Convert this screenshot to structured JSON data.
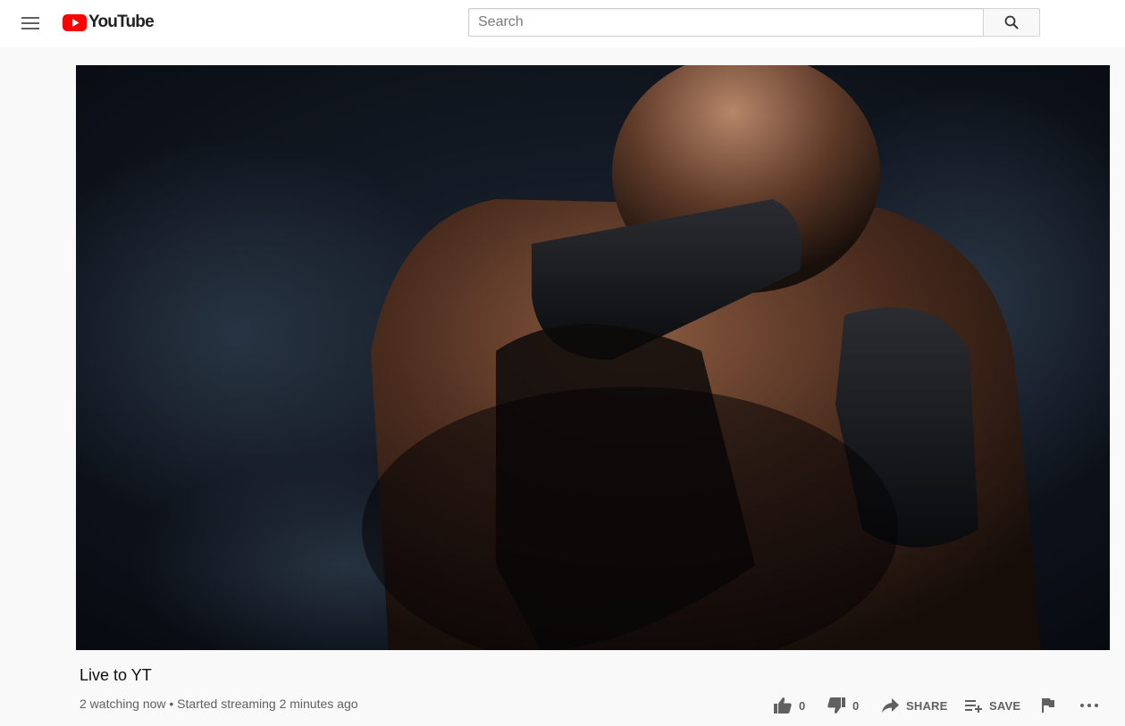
{
  "header": {
    "logo_text": "YouTube",
    "search": {
      "placeholder": "Search",
      "value": ""
    }
  },
  "video": {
    "title": "Live to YT",
    "meta": "2 watching now • Started streaming 2 minutes ago"
  },
  "actions": {
    "like_count": "0",
    "dislike_count": "0",
    "share_label": "SHARE",
    "save_label": "SAVE"
  },
  "colors": {
    "brand_red": "#ff0000",
    "icon_gray": "#606060",
    "background": "#f9f9f9"
  },
  "icons": [
    "menu-icon",
    "youtube-logo-icon",
    "search-icon",
    "like-icon",
    "dislike-icon",
    "share-icon",
    "playlist-add-icon",
    "flag-icon",
    "more-icon"
  ]
}
